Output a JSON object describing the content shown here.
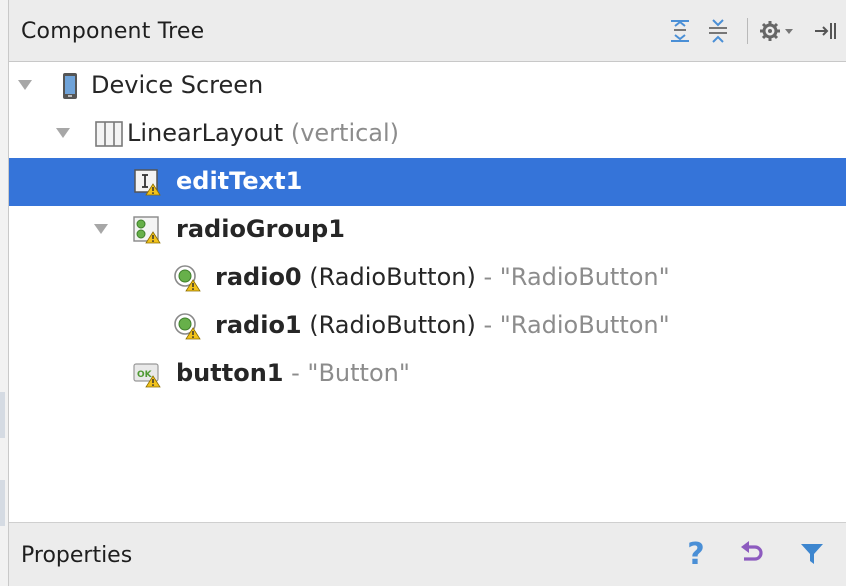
{
  "component_tree": {
    "title": "Component Tree",
    "toolbar": {
      "expand_all": "expand-all-icon",
      "collapse_all": "collapse-all-icon",
      "settings": "gear-menu-icon",
      "hide": "hide-panel-icon"
    },
    "items": [
      {
        "name": "Device Screen",
        "type": "",
        "text": ""
      },
      {
        "name": "LinearLayout",
        "type": "(vertical)",
        "text": ""
      },
      {
        "name": "editText1",
        "type": "",
        "text": ""
      },
      {
        "name": "radioGroup1",
        "type": "",
        "text": ""
      },
      {
        "name": "radio0",
        "type": "(RadioButton)",
        "text": "- \"RadioButton\""
      },
      {
        "name": "radio1",
        "type": "(RadioButton)",
        "text": "- \"RadioButton\""
      },
      {
        "name": "button1",
        "type": "",
        "text": "- \"Button\""
      }
    ]
  },
  "properties": {
    "title": "Properties",
    "help": "?"
  },
  "colors": {
    "selection": "#3574d9",
    "header_bg": "#ececec",
    "muted_text": "#8c8c8c",
    "accent_blue": "#4a8fd6",
    "undo_purple": "#8d5bbf"
  }
}
